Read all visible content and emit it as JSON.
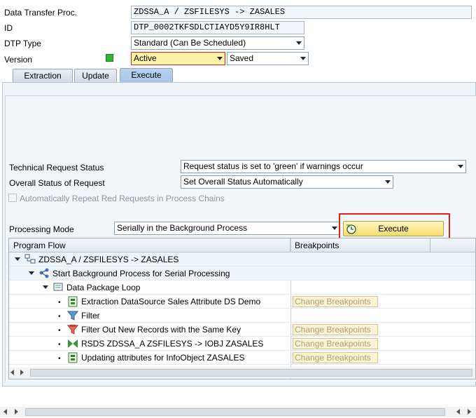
{
  "header": {
    "dtp_proc_label": "Data Transfer Proc.",
    "dtp_proc_value": "ZDSSA_A / ZSFILESYS -> ZASALES",
    "id_label": "ID",
    "id_value": "DTP_0002TKFSDLCTIAYD5Y9IR8HLT",
    "dtp_type_label": "DTP Type",
    "dtp_type_value": "Standard (Can Be Scheduled)",
    "version_label": "Version",
    "version_active": "Active",
    "version_saved": "Saved"
  },
  "tabs": [
    {
      "label": "Extraction"
    },
    {
      "label": "Update"
    },
    {
      "label": "Execute"
    }
  ],
  "execute": {
    "tech_status_label": "Technical Request Status",
    "tech_status_value": "Request status is set to 'green' if warnings occur",
    "overall_status_label": "Overall Status of Request",
    "overall_status_value": "Set Overall Status Automatically",
    "auto_repeat_label": "Automatically Repeat Red Requests in Process Chains",
    "processing_mode_label": "Processing Mode",
    "processing_mode_value": "Serially in the Background Process",
    "execute_button": "Execute"
  },
  "tree": {
    "col_flow": "Program Flow",
    "col_bp": "Breakpoints",
    "rows": [
      {
        "text": "ZDSSA_A / ZSFILESYS -> ZASALES",
        "icon": "dtp-icon"
      },
      {
        "text": "Start Background Process for Serial Processing",
        "icon": "process-icon"
      },
      {
        "text": "Data Package Loop",
        "icon": "loop-icon"
      },
      {
        "text": "Extraction DataSource Sales Attribute DS Demo",
        "icon": "datasource-icon",
        "bp": "Change Breakpoints"
      },
      {
        "text": "Filter",
        "icon": "filter-icon"
      },
      {
        "text": "Filter Out New Records with the Same Key",
        "icon": "filter-key-icon",
        "bp": "Change Breakpoints"
      },
      {
        "text": "RSDS ZDSSA_A ZSFILESYS -> IOBJ ZASALES",
        "icon": "transformation-icon",
        "bp": "Change Breakpoints"
      },
      {
        "text": "Updating attributes for InfoObject ZASALES",
        "icon": "infoobject-icon",
        "bp": "Change Breakpoints"
      }
    ]
  },
  "colors": {
    "active_bg": "#fdf2a5",
    "highlight_border": "#e0201c",
    "status_green": "#2fb82f"
  }
}
